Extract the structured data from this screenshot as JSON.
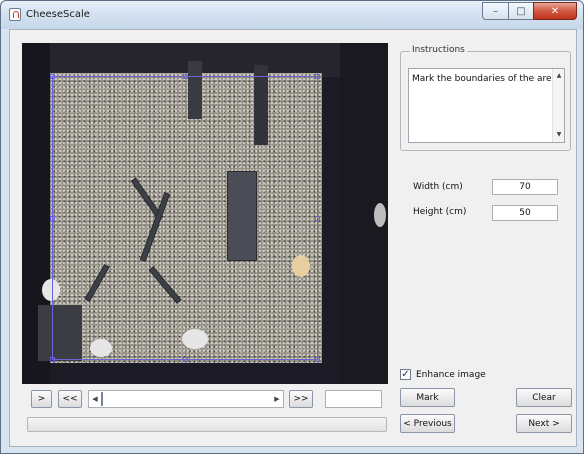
{
  "window": {
    "title": "CheeseScale",
    "minimize_glyph": "–",
    "maximize_glyph": "□",
    "close_glyph": "✕"
  },
  "instructions": {
    "legend": "Instructions",
    "text": "Mark the boundaries of the arena",
    "scroll_up_glyph": "▲",
    "scroll_down_glyph": "▼"
  },
  "dimensions": {
    "width_label": "Width (cm)",
    "width_value": "70",
    "height_label": "Height (cm)",
    "height_value": "50"
  },
  "enhance": {
    "label": "Enhance image",
    "checked": true,
    "check_glyph": "✓"
  },
  "navigation": {
    "step_forward_label": ">",
    "rewind_label": "<<",
    "fast_forward_label": ">>",
    "slider_left_glyph": "◀",
    "slider_right_glyph": "▶",
    "slider_position": 0.0,
    "frame_value": ""
  },
  "actions": {
    "mark_label": "Mark",
    "clear_label": "Clear",
    "previous_label": "< Previous",
    "next_label": "Next >"
  },
  "progress": {
    "fraction": 0.0
  },
  "colors": {
    "selection": "#6a63d6",
    "progress": "#37b24a"
  }
}
